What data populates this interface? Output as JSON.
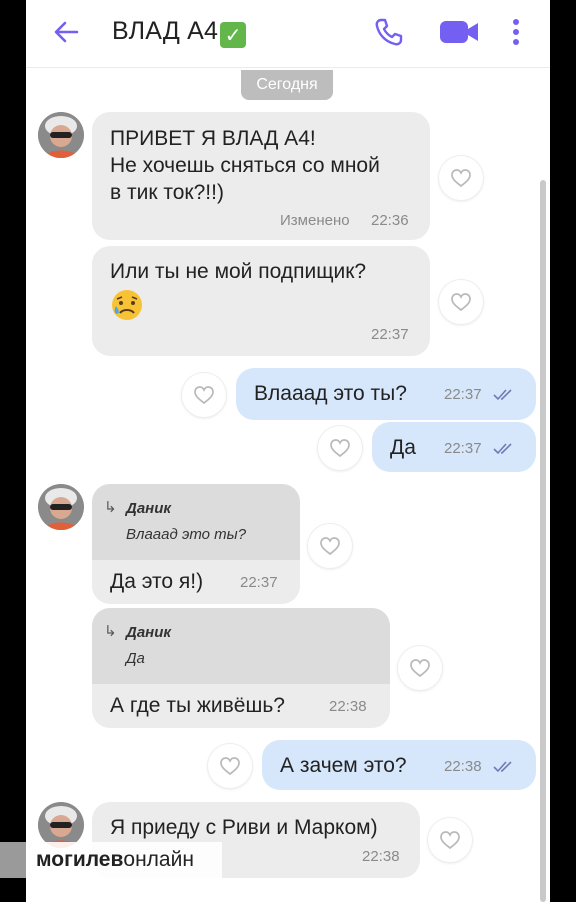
{
  "header": {
    "title": "ВЛАД А4",
    "verified_mark": "✓",
    "back_icon": "arrow-left-icon",
    "call_icon": "phone-icon",
    "video_icon": "video-camera-icon",
    "more_icon": "more-vertical-icon",
    "accent_color": "#7360f2"
  },
  "date_separator": "Сегодня",
  "messages": [
    {
      "dir": "in",
      "lines": [
        "ПРИВЕТ Я ВЛАД А4!",
        "Не хочешь сняться со мной",
        "в тик ток?!!)"
      ],
      "edited": "Изменено",
      "time": "22:36"
    },
    {
      "dir": "in",
      "lines": [
        "Или ты не мой подпищик?"
      ],
      "emoji": "sad-sweat-face-emoji",
      "time": "22:37"
    },
    {
      "dir": "out",
      "text": "Влааад это ты?",
      "time": "22:37"
    },
    {
      "dir": "out",
      "text": "Да",
      "time": "22:37"
    },
    {
      "dir": "in",
      "reply_name": "Даник",
      "reply_text": "Влааад это ты?",
      "text": "Да это я!)",
      "time": "22:37"
    },
    {
      "dir": "in",
      "reply_name": "Даник",
      "reply_text": "Да",
      "text": "А где ты живёшь?",
      "time": "22:38"
    },
    {
      "dir": "out",
      "text": "А зачем это?",
      "time": "22:38"
    },
    {
      "dir": "in",
      "text": "Я приеду с Риви и Марком)",
      "time": "22:38"
    }
  ],
  "colors": {
    "incoming_bubble": "#ececec",
    "outgoing_bubble": "#d6e7fb",
    "read_ticks": "#6f7bb5"
  },
  "watermark": {
    "bold": "могилев",
    "regular": "онлайн"
  }
}
